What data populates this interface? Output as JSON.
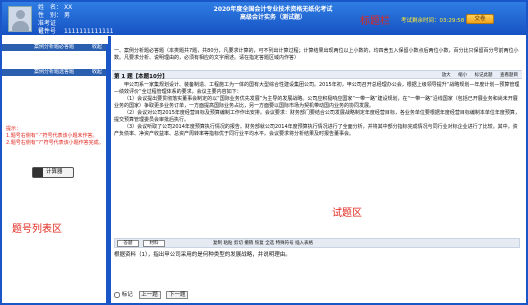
{
  "candidate": {
    "name_label": "姓　名：",
    "name_value": "XX",
    "gender_label": "性　别：",
    "gender_value": "男",
    "exam_no_label": "准考证号：",
    "exam_no_value": "1111111111111",
    "id_label": "证件号码：",
    "id_value": "111111111111111111"
  },
  "header": {
    "line1": "2020年度全国会计专业技术资格无纸化考试",
    "line2": "高级会计实务（测试题）",
    "zone_label": "标题栏",
    "timer_label": "考试剩余时间：",
    "timer_value": "03:29:58",
    "submit_label": "交卷"
  },
  "left_panel": {
    "head1": "案例分析题必答题",
    "head2": "案例分析题选答题",
    "close1": "收起",
    "close2": "收起",
    "tip": "提示：\n1.题号右侧有“·”符号代表该小题未作答。\n2.题号右侧有“?”符号代表该小题作答完成。",
    "calc_label": "计算器",
    "zone_label": "题号列表区"
  },
  "main": {
    "instr": "一、案例分析题必答题（本类题共7题，共80分，凡要求计算的，可不列出计算过程；计算结果出现两位以上小数的，均四舍五入保留小数点后两位小数，百分比只保留百分号前两位小数。凡要求分析、说明理由的，必须有相应的文字阐述。请在指定答题区域内作答）",
    "q_title": "第 1 题【本题10分】",
    "tools": [
      "放大",
      "缩小",
      "标记此题",
      "查看题目"
    ],
    "passage": [
      "甲公司系一家集规划设计、装备制造、工程施工为一体的国有大型综合性建设集团公司。2015年初，甲公司召开总经理办公会，根据上级领导提升“战略规划—年度计划—预算管理—绩效评价”全过程管理体系的要求，会议主要内容如下：",
      "（1）会议提出要贯彻落实董事会制定的以“国际业务优先发展”为主导的发展战略。公司应积极响应国家“一带一路”建设规划，在“一带一路”沿线国家（包括已开展业务和尚未开展业务的国家）争取更多业务订单，一方面提高国际业务占比，另一方面要以国际市场为契机带动国内业务的协同发展。",
      "（2）会议对公司2015年度经营目标及预算编制工作作出安排。会议要求：财务部门要结合公司发展战略制定年度经营目标，各业务单位要根据年度经营目标编制本单位年度预算，提交预算管理委员会审批后执行。",
      "（3）会议听取了公司2014年度预算执行情况的报告。财务部就公司2014年度预算执行情况进行了全面分析，并将其中部分指标完成情况与同行业对标企业进行了比较，其中，资产负债率、净资产收益率、总资产周转率等指标优于同行业平均水平。会议要求将分析结果及时报告董事会。"
    ],
    "subtabs": [
      "答题",
      "材料"
    ],
    "subtools": [
      "复制",
      "粘贴",
      "剪切",
      "撤销",
      "恢复",
      "全选",
      "特殊符号",
      "插入表格"
    ],
    "question": "根据资料（1），指出甲公司采用的是何种类型的发展战略，并说明理由。",
    "mark_label": "标记",
    "prev_label": "上一题",
    "next_label": "下一题",
    "zone_label": "试题区"
  }
}
